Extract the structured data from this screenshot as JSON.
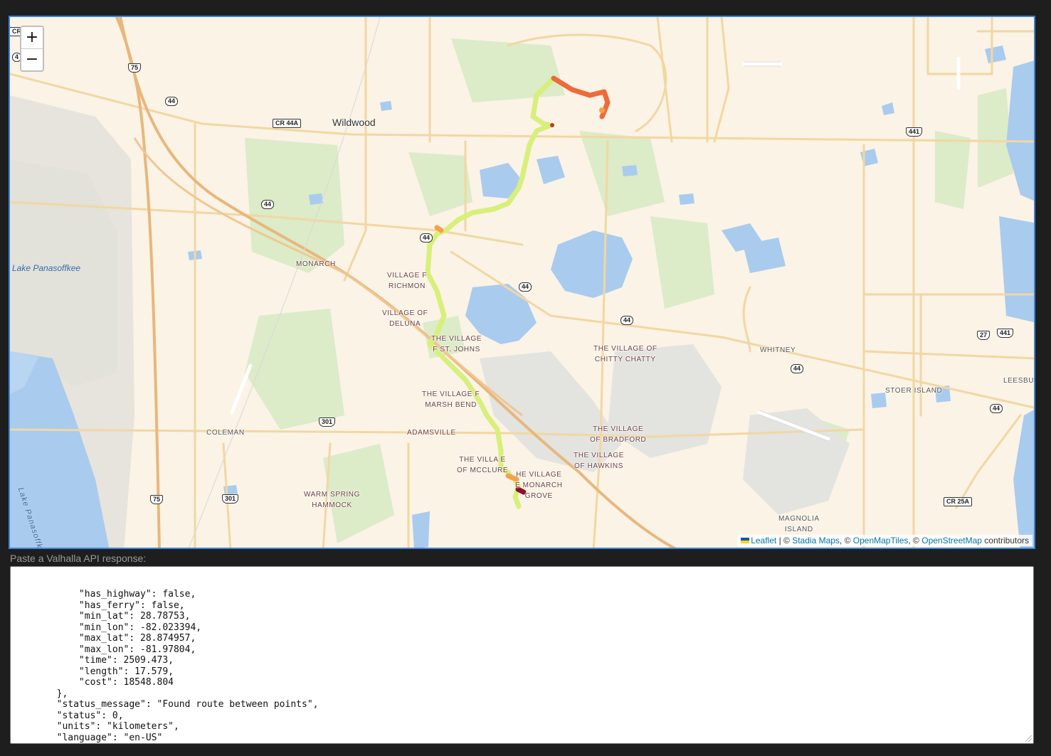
{
  "map": {
    "zoom_in_label": "+",
    "zoom_out_label": "−",
    "attribution": {
      "leaflet": "Leaflet",
      "sep1": "| ©",
      "stadia": "Stadia Maps",
      "sep2": ", ©",
      "openmaptiles": "OpenMapTiles",
      "sep3": ", ©",
      "osm": "OpenStreetMap",
      "suffix": "contributors"
    },
    "cities": {
      "wildwood": "Wildwood"
    },
    "water_labels": {
      "lake_panasoffkee": "Lake Panasoffkee",
      "lake_panasoffkee_vertical": "Lake Panasoffkee"
    },
    "places": {
      "monarch": "MONARCH",
      "richmon_1": "VILLAGE",
      "richmon_2": "F",
      "richmon_3": "RICHMON",
      "deluna_1": "VILLAGE OF",
      "deluna_2": "DELUNA",
      "stjohns_1": "THE VILLAGE",
      "stjohns_2": "F ST. JOHNS",
      "chitty_1": "THE VILLAGE OF",
      "chitty_2": "CHITTY CHATTY",
      "whitney": "WHITNEY",
      "marsh_1": "THE VILLAGE",
      "marsh_2": "F",
      "marsh_3": "MARSH BEND",
      "coleman": "COLEMAN",
      "adamsville": "ADAMSVILLE",
      "bradford_1": "THE VILLAGE",
      "bradford_2": "OF BRADFORD",
      "hawkins_1": "THE VILLAGE",
      "hawkins_2": "OF HAWKINS",
      "mcclure_1": "THE VILLA",
      "mcclure_2": "E",
      "mcclure_3": "OF MCCLURE",
      "monarch_grove_1": "HE VILLAGE",
      "monarch_grove_2": "E MONARCH",
      "monarch_grove_3": "GROVE",
      "warm_spring_1": "WARM SPRING",
      "warm_spring_2": "HAMMOCK",
      "stoer_island": "STOER ISLAND",
      "leesburg": "LEESBUR",
      "magnolia_1": "MAGNOLIA",
      "magnolia_2": "ISLAND"
    },
    "shields": {
      "cr_top": "CR",
      "n4": "4",
      "i75_top": "75",
      "r44_a": "44",
      "cr44a": "CR 44A",
      "r44_b": "44",
      "r44_c": "44",
      "r44_d": "44",
      "r44_e": "44",
      "r44_f": "44",
      "r44_g": "44",
      "us441_top": "441",
      "r27": "27",
      "us441_mid": "441",
      "us301_a": "301",
      "us301_b": "301",
      "i75_bottom": "75",
      "cr25a": "CR 25A"
    },
    "route_colors": {
      "fast": "#d8ef7a",
      "medium": "#f6a04d",
      "slow": "#ef6a3a",
      "stop": "#8c1028"
    }
  },
  "panel": {
    "prompt": "Paste a Valhalla API response:",
    "json_lines": [
      "            \"has_highway\": false,",
      "            \"has_ferry\": false,",
      "            \"min_lat\": 28.78753,",
      "            \"min_lon\": -82.023394,",
      "            \"max_lat\": 28.874957,",
      "            \"max_lon\": -81.97804,",
      "            \"time\": 2509.473,",
      "            \"length\": 17.579,",
      "            \"cost\": 18548.804",
      "        },",
      "        \"status_message\": \"Found route between points\",",
      "        \"status\": 0,",
      "        \"units\": \"kilometers\",",
      "        \"language\": \"en-US\"",
      "    }",
      "}"
    ]
  }
}
